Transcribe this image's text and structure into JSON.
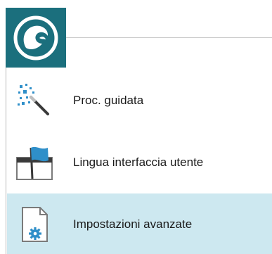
{
  "app_button": {
    "icon": "app-logo-wave-icon",
    "bg_color": "#1b6f7d"
  },
  "menu": {
    "items": [
      {
        "label": "Proc. guidata",
        "icon": "magic-wand-icon",
        "selected": false
      },
      {
        "label": "Lingua interfaccia utente",
        "icon": "flag-window-icon",
        "selected": false
      },
      {
        "label": "Impostazioni avanzate",
        "icon": "settings-document-icon",
        "selected": true
      }
    ],
    "selected_color": "#cde8f0"
  }
}
